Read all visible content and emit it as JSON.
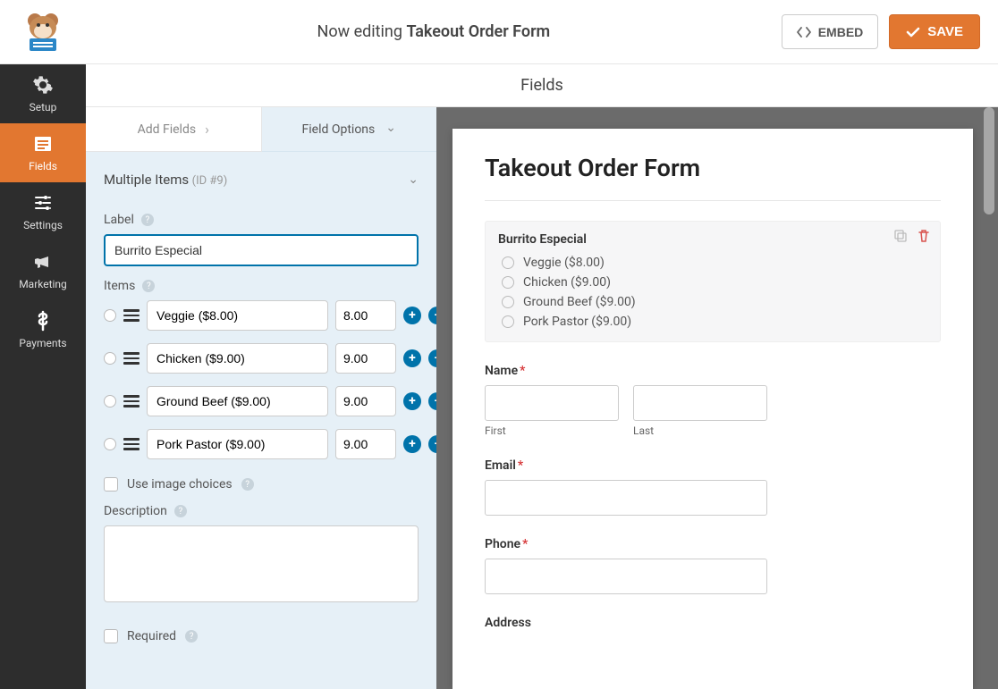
{
  "header": {
    "now_editing": "Now editing",
    "form_name": "Takeout Order Form",
    "embed": "EMBED",
    "save": "SAVE"
  },
  "sidebar": {
    "items": [
      {
        "label": "Setup"
      },
      {
        "label": "Fields"
      },
      {
        "label": "Settings"
      },
      {
        "label": "Marketing"
      },
      {
        "label": "Payments"
      }
    ]
  },
  "main_header": {
    "title": "Fields"
  },
  "panel_tabs": {
    "add_fields": "Add Fields",
    "field_options": "Field Options"
  },
  "option_panel": {
    "section_title": "Multiple Items",
    "section_id": "(ID #9)",
    "label_label": "Label",
    "label_value": "Burrito Especial",
    "items_label": "Items",
    "items": [
      {
        "name": "Veggie ($8.00)",
        "price": "8.00"
      },
      {
        "name": "Chicken ($9.00)",
        "price": "9.00"
      },
      {
        "name": "Ground Beef ($9.00)",
        "price": "9.00"
      },
      {
        "name": "Pork Pastor ($9.00)",
        "price": "9.00"
      }
    ],
    "use_image_choices": "Use image choices",
    "description_label": "Description",
    "required_label": "Required"
  },
  "preview": {
    "form_title": "Takeout Order Form",
    "selected_field_label": "Burrito Especial",
    "selected_options": [
      "Veggie ($8.00)",
      "Chicken ($9.00)",
      "Ground Beef ($9.00)",
      "Pork Pastor ($9.00)"
    ],
    "name_label": "Name",
    "first": "First",
    "last": "Last",
    "email_label": "Email",
    "phone_label": "Phone",
    "address_label": "Address"
  }
}
